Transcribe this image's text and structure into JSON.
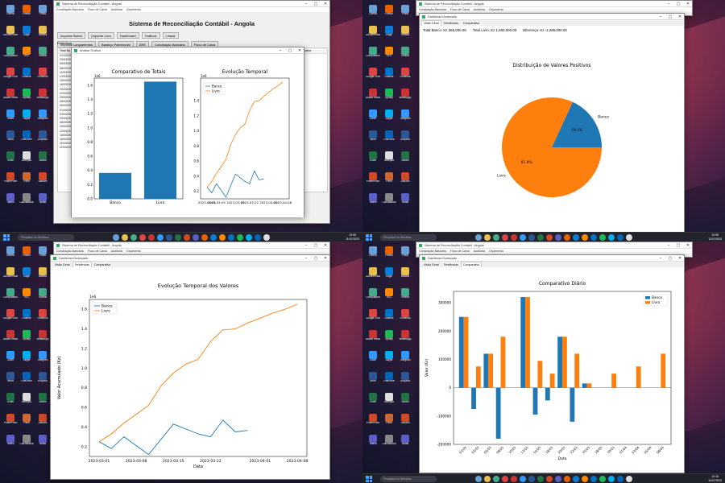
{
  "desktop": {
    "icon_labels": [
      "Lixeira",
      "Documentos",
      "Computador",
      "Google Chrome",
      "Adobe Reader",
      "Zoom",
      "Word",
      "Excel",
      "PowerPoint",
      "Teams",
      "Firefox",
      "Edge",
      "VLC",
      "Outlook",
      "Spotify",
      "Skype",
      "OneDrive",
      "Notepad",
      "Paint",
      "Calculadora",
      "Fotos",
      "Música",
      "Vídeos",
      "Ficheiros",
      "WhatsApp",
      "Telegram",
      "Dropbox",
      "Steam",
      "Discord",
      "Notas"
    ],
    "search_placeholder": "Pesquisar no Windows",
    "clock_time": "13:08",
    "clock_date": "11/07/2023",
    "clock_time_q4": "13:15"
  },
  "app": {
    "window_title": "Sistema de Reconciliação Contábil - Angola",
    "menu": [
      "Conciliação Bancária",
      "Fluxo de Caixa",
      "Auditoria",
      "Orçamento"
    ],
    "heading": "Sistema de Reconciliação Contábil - Angola",
    "buttons_row1": [
      "Importar Banco",
      "Importar Livro",
      "Dashboard",
      "Gráficos",
      "Limpar"
    ],
    "buttons_row2": [
      "Importar Lançamentos",
      "Balanço Patrimonial",
      "DRE",
      "Conciliação Bancária",
      "Fluxo de Caixa"
    ],
    "stats_label": "Estatísticas",
    "total_label": "Total Ba",
    "status_col": "Status",
    "dates": [
      "01/03/202",
      "03/03/202",
      "05/03/202",
      "08/03/202",
      "10/03/202",
      "13/03/202",
      "15/03/202",
      "18/03/202",
      "20/03/202",
      "22/03/202",
      "25/03/202",
      "28/03/202",
      "30/03/202",
      "01/04/202",
      "03/04/202",
      "05/04/202",
      "08/04/202",
      "10/04/202",
      "12/04/202",
      "15/04/202",
      "18/04/202",
      "20/04/202",
      "22/04/202"
    ]
  },
  "graphs": {
    "window_title": "Análise Gráfica",
    "bar_title": "Comparativo de Totais",
    "line_title": "Evolução Temporal",
    "scale_label": "1e6",
    "legend_banco": "Banco",
    "legend_livro": "Livro"
  },
  "dash": {
    "window_title": "Dashboard Avançado",
    "tabs": [
      "Visão Geral",
      "Tendências",
      "Comparativo"
    ],
    "total_banco": "Total Banco: Kz 365,000.00",
    "total_livro": "Total Livro: Kz 1,650,000.00",
    "diferenca": "Diferença: Kz -1,285,000.00",
    "pie_title": "Distribuição de Valores Positivos",
    "pie_banco_pct": "18.1%",
    "pie_livro_pct": "81.9%",
    "pie_banco_label": "Banco",
    "pie_livro_label": "Livro",
    "trend_title": "Evolução Temporal dos Valores",
    "trend_ylabel": "Valor Acumulado (Kz)",
    "trend_xlabel": "Data",
    "comp_title": "Comparativo Diário",
    "comp_ylabel": "Valor (Kz)",
    "comp_xlabel": "Data"
  },
  "colors": {
    "banco": "#1f77b4",
    "livro": "#ff7f0e"
  },
  "chart_data": [
    {
      "type": "bar",
      "title": "Comparativo de Totais",
      "categories": [
        "Banco",
        "Livro"
      ],
      "values": [
        365000,
        1650000
      ],
      "ylim": [
        0,
        1700000
      ],
      "scale": "1e6",
      "yticks": [
        "0.0",
        "0.2",
        "0.4",
        "0.6",
        "0.8",
        "1.0",
        "1.2",
        "1.4",
        "1.6"
      ]
    },
    {
      "type": "line",
      "title": "Evolução Temporal",
      "x": [
        "2023-03-01",
        "2023-03-03",
        "2023-03-05",
        "2023-03-08",
        "2023-03-10",
        "2023-03-13",
        "2023-03-15",
        "2023-03-18",
        "2023-03-20",
        "2023-03-22",
        "2023-03-25",
        "2023-03-28",
        "2023-03-30",
        "2023-04-01",
        "2023-04-03",
        "2023-04-05",
        "2023-04-08"
      ],
      "series": [
        {
          "name": "Banco",
          "values": [
            250000,
            180000,
            300000,
            null,
            120000,
            null,
            430000,
            null,
            330000,
            300000,
            470000,
            350000,
            365000,
            null,
            null,
            null,
            null
          ]
        },
        {
          "name": "Livro",
          "values": [
            250000,
            330000,
            440000,
            null,
            620000,
            820000,
            950000,
            1040000,
            1090000,
            1270000,
            1390000,
            1400000,
            1460000,
            1510000,
            1560000,
            1600000,
            1650000
          ]
        }
      ],
      "ylim": [
        100000,
        1700000
      ]
    },
    {
      "type": "pie",
      "title": "Distribuição de Valores Positivos",
      "categories": [
        "Banco",
        "Livro"
      ],
      "values": [
        18.1,
        81.9
      ]
    },
    {
      "type": "bar",
      "title": "Comparativo Diário",
      "categories": [
        "01/03",
        "03/03",
        "05/03",
        "08/03",
        "10/03",
        "13/03",
        "15/03",
        "18/03",
        "20/03",
        "22/03",
        "25/03",
        "28/03",
        "30/03",
        "01/04",
        "03/04",
        "05/04",
        "08/04"
      ],
      "series": [
        {
          "name": "Banco",
          "values": [
            250000,
            -75000,
            120000,
            -180000,
            0,
            320000,
            -95000,
            -45000,
            180000,
            -120000,
            15000,
            0,
            0,
            0,
            0,
            0,
            0
          ]
        },
        {
          "name": "Livro",
          "values": [
            250000,
            75000,
            120000,
            180000,
            0,
            320000,
            95000,
            50000,
            180000,
            120000,
            15000,
            0,
            50000,
            0,
            75000,
            0,
            120000
          ]
        }
      ],
      "ylim": [
        -200000,
        340000
      ],
      "yticks": [
        "-200000",
        "-100000",
        "0",
        "100000",
        "200000",
        "300000"
      ]
    }
  ]
}
